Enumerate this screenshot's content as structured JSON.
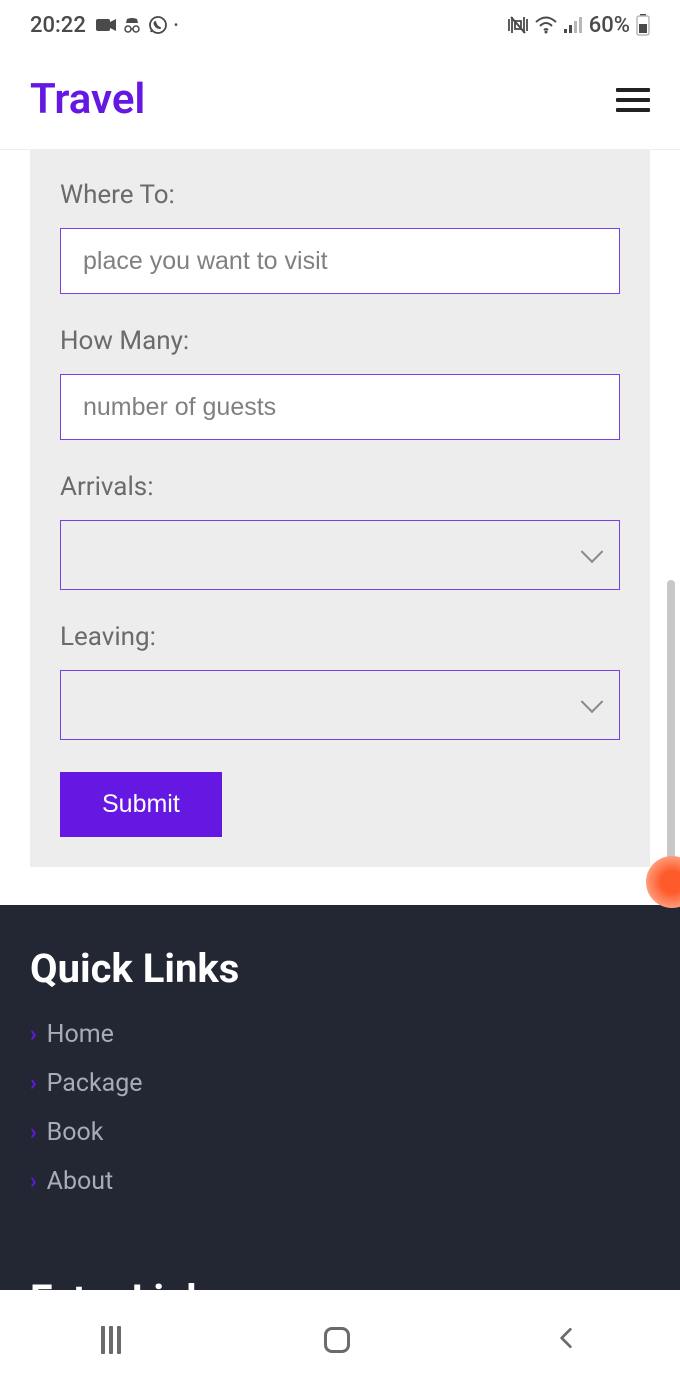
{
  "status": {
    "time": "20:22",
    "battery": "60%"
  },
  "header": {
    "brand": "Travel"
  },
  "form": {
    "where_to": {
      "label": "Where To:",
      "placeholder": "place you want to visit",
      "value": ""
    },
    "how_many": {
      "label": "How Many:",
      "placeholder": "number of guests",
      "value": ""
    },
    "arrivals": {
      "label": "Arrivals:",
      "value": ""
    },
    "leaving": {
      "label": "Leaving:",
      "value": ""
    },
    "submit": "Submit"
  },
  "footer": {
    "quicklinks": {
      "heading": "Quick Links",
      "items": [
        "Home",
        "Package",
        "Book",
        "About"
      ]
    },
    "extralinks": {
      "heading": "Extra Links"
    }
  }
}
